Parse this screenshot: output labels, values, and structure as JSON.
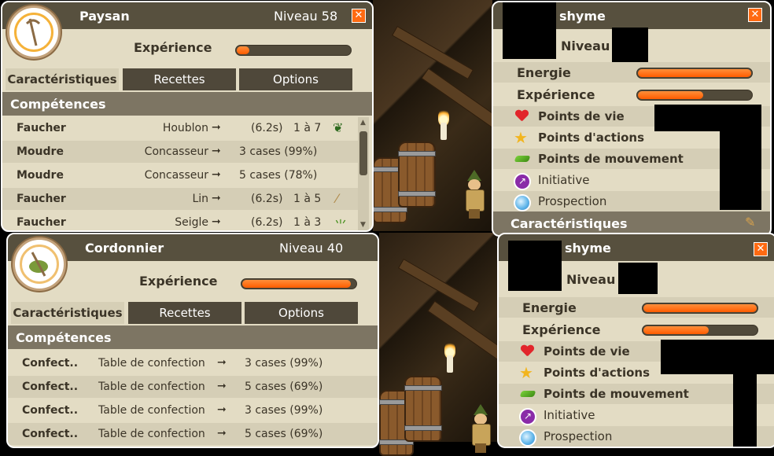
{
  "jobs": [
    {
      "title": "Paysan",
      "level": "Niveau 58",
      "xp_label": "Expérience",
      "xp_fraction": 0.06,
      "tabs": [
        "Caractéristiques",
        "Recettes",
        "Options"
      ],
      "section": "Compétences",
      "rows": [
        {
          "skill": "Faucher",
          "target": "Houblon",
          "arrow": "➞",
          "result": "(6.2s)",
          "extra": "1 à 7"
        },
        {
          "skill": "Moudre",
          "target": "Concasseur",
          "arrow": "➞",
          "result": "3 cases (99%)",
          "extra": ""
        },
        {
          "skill": "Moudre",
          "target": "Concasseur",
          "arrow": "➞",
          "result": "5 cases (78%)",
          "extra": ""
        },
        {
          "skill": "Faucher",
          "target": "Lin",
          "arrow": "➞",
          "result": "(6.2s)",
          "extra": "1 à 5"
        },
        {
          "skill": "Faucher",
          "target": "Seigle",
          "arrow": "➞",
          "result": "(6.2s)",
          "extra": "1 à 3"
        }
      ]
    },
    {
      "title": "Cordonnier",
      "level": "Niveau 40",
      "xp_label": "Expérience",
      "xp_fraction": 0.95,
      "tabs": [
        "Caractéristiques",
        "Recettes",
        "Options"
      ],
      "section": "Compétences",
      "rows": [
        {
          "skill": "Confect..",
          "target": "Table de confection",
          "arrow": "➞",
          "result": "3 cases (99%)"
        },
        {
          "skill": "Confect..",
          "target": "Table de confection",
          "arrow": "➞",
          "result": "5 cases (69%)"
        },
        {
          "skill": "Confect..",
          "target": "Table de confection",
          "arrow": "➞",
          "result": "3 cases (99%)"
        },
        {
          "skill": "Confect..",
          "target": "Table de confection",
          "arrow": "➞",
          "result": "5 cases (69%)"
        }
      ]
    }
  ],
  "stats": [
    {
      "name": "shyme",
      "level_label": "Niveau",
      "energie_label": "Energie",
      "energie_fraction": 0.99,
      "xp_label": "Expérience",
      "xp_fraction": 0.57,
      "rows": [
        "Points de vie",
        "Points d'actions",
        "Points de mouvement",
        "Initiative",
        "Prospection"
      ],
      "section": "Caractéristiques"
    },
    {
      "name": "shyme",
      "level_label": "Niveau",
      "energie_label": "Energie",
      "energie_fraction": 0.99,
      "xp_label": "Expérience",
      "xp_fraction": 0.57,
      "rows": [
        "Points de vie",
        "Points d'actions",
        "Points de mouvement",
        "Initiative",
        "Prospection"
      ]
    }
  ],
  "icons": {
    "close": "close-icon",
    "arrow": "arrow-right-icon",
    "heart": "heart-icon",
    "star": "star-icon",
    "boot": "movement-icon",
    "initiative": "initiative-icon",
    "prospection": "prospection-icon"
  },
  "colors": {
    "header": "#57503e",
    "panel": "#e3dcc4",
    "accent": "#ff6a12",
    "bar_fill": "#ff5c00"
  }
}
